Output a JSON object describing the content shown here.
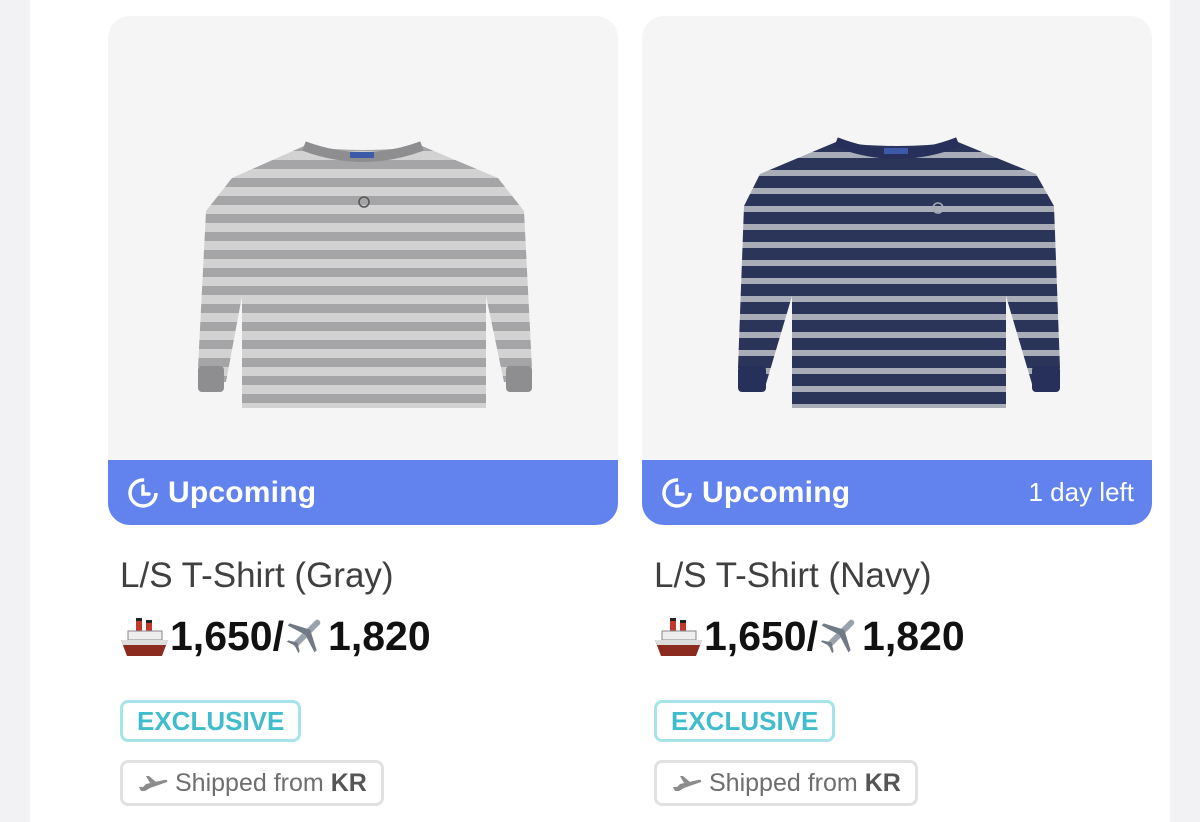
{
  "products": [
    {
      "image_alt": "L/S T-Shirt (Gray)",
      "shirt_colors": {
        "body": "#a5a5a7",
        "stripe": "#d2d2d2",
        "cuff": "#8e8e90"
      },
      "status": {
        "label": "Upcoming",
        "days_left": ""
      },
      "title": "L/S T-Shirt (Gray)",
      "price": {
        "ship_icon": "ship-icon",
        "ship_price": "1,650",
        "separator": "/",
        "air_icon": "airplane-icon",
        "air_price": "1,820"
      },
      "tags": {
        "exclusive": "EXCLUSIVE",
        "shipped_text": "Shipped from",
        "shipped_country": "KR"
      }
    },
    {
      "image_alt": "L/S T-Shirt (Navy)",
      "shirt_colors": {
        "body": "#2b355a",
        "stripe": "#a8adb8",
        "cuff": "#27305a"
      },
      "status": {
        "label": "Upcoming",
        "days_left": "1 day left"
      },
      "title": "L/S T-Shirt (Navy)",
      "price": {
        "ship_icon": "ship-icon",
        "ship_price": "1,650",
        "separator": "/",
        "air_icon": "airplane-icon",
        "air_price": "1,820"
      },
      "tags": {
        "exclusive": "EXCLUSIVE",
        "shipped_text": "Shipped from",
        "shipped_country": "KR"
      }
    }
  ],
  "colors": {
    "status_bar": "#6283ee",
    "exclusive": "#3fbdcc",
    "card_bg": "#f5f5f5"
  }
}
